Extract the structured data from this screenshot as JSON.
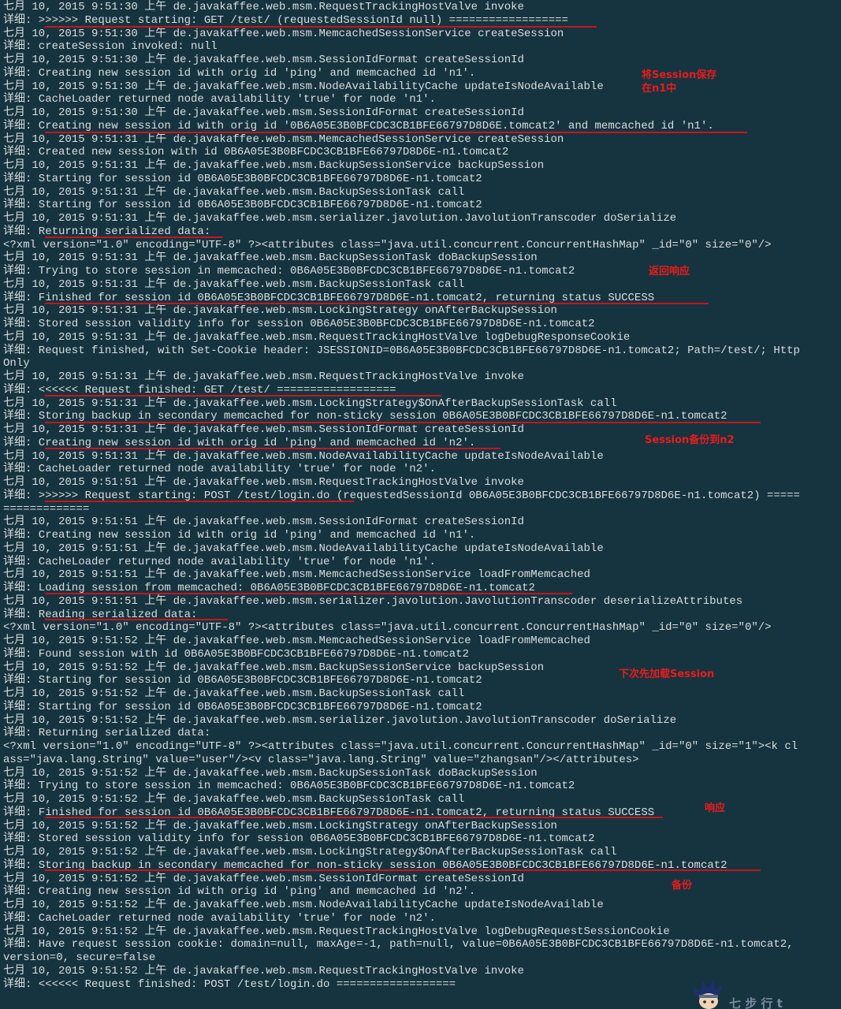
{
  "log_lines": [
    "七月 10, 2015 9:51:30 上午 de.javakaffee.web.msm.RequestTrackingHostValve invoke",
    "详细: >>>>>> Request starting: GET /test/ (requestedSessionId null) ==================",
    "七月 10, 2015 9:51:30 上午 de.javakaffee.web.msm.MemcachedSessionService createSession",
    "详细: createSession invoked: null",
    "七月 10, 2015 9:51:30 上午 de.javakaffee.web.msm.SessionIdFormat createSessionId",
    "详细: Creating new session id with orig id 'ping' and memcached id 'n1'.",
    "七月 10, 2015 9:51:30 上午 de.javakaffee.web.msm.NodeAvailabilityCache updateIsNodeAvailable",
    "详细: CacheLoader returned node availability 'true' for node 'n1'.",
    "七月 10, 2015 9:51:30 上午 de.javakaffee.web.msm.SessionIdFormat createSessionId",
    "详细: Creating new session id with orig id '0B6A05E3B0BFCDC3CB1BFE66797D8D6E.tomcat2' and memcached id 'n1'.",
    "七月 10, 2015 9:51:31 上午 de.javakaffee.web.msm.MemcachedSessionService createSession",
    "详细: Created new session with id 0B6A05E3B0BFCDC3CB1BFE66797D8D6E-n1.tomcat2",
    "七月 10, 2015 9:51:31 上午 de.javakaffee.web.msm.BackupSessionService backupSession",
    "详细: Starting for session id 0B6A05E3B0BFCDC3CB1BFE66797D8D6E-n1.tomcat2",
    "七月 10, 2015 9:51:31 上午 de.javakaffee.web.msm.BackupSessionTask call",
    "详细: Starting for session id 0B6A05E3B0BFCDC3CB1BFE66797D8D6E-n1.tomcat2",
    "七月 10, 2015 9:51:31 上午 de.javakaffee.web.msm.serializer.javolution.JavolutionTranscoder doSerialize",
    "详细: Returning serialized data:",
    "<?xml version=\"1.0\" encoding=\"UTF-8\" ?><attributes class=\"java.util.concurrent.ConcurrentHashMap\" _id=\"0\" size=\"0\"/>",
    "七月 10, 2015 9:51:31 上午 de.javakaffee.web.msm.BackupSessionTask doBackupSession",
    "详细: Trying to store session in memcached: 0B6A05E3B0BFCDC3CB1BFE66797D8D6E-n1.tomcat2",
    "七月 10, 2015 9:51:31 上午 de.javakaffee.web.msm.BackupSessionTask call",
    "详细: Finished for session id 0B6A05E3B0BFCDC3CB1BFE66797D8D6E-n1.tomcat2, returning status SUCCESS",
    "七月 10, 2015 9:51:31 上午 de.javakaffee.web.msm.LockingStrategy onAfterBackupSession",
    "详细: Stored session validity info for session 0B6A05E3B0BFCDC3CB1BFE66797D8D6E-n1.tomcat2",
    "七月 10, 2015 9:51:31 上午 de.javakaffee.web.msm.RequestTrackingHostValve logDebugResponseCookie",
    "详细: Request finished, with Set-Cookie header: JSESSIONID=0B6A05E3B0BFCDC3CB1BFE66797D8D6E-n1.tomcat2; Path=/test/; Http",
    "Only",
    "七月 10, 2015 9:51:31 上午 de.javakaffee.web.msm.RequestTrackingHostValve invoke",
    "详细: <<<<<< Request finished: GET /test/ ==================",
    "七月 10, 2015 9:51:31 上午 de.javakaffee.web.msm.LockingStrategy$OnAfterBackupSessionTask call",
    "详细: Storing backup in secondary memcached for non-sticky session 0B6A05E3B0BFCDC3CB1BFE66797D8D6E-n1.tomcat2",
    "七月 10, 2015 9:51:31 上午 de.javakaffee.web.msm.SessionIdFormat createSessionId",
    "详细: Creating new session id with orig id 'ping' and memcached id 'n2'.",
    "七月 10, 2015 9:51:31 上午 de.javakaffee.web.msm.NodeAvailabilityCache updateIsNodeAvailable",
    "详细: CacheLoader returned node availability 'true' for node 'n2'.",
    "七月 10, 2015 9:51:51 上午 de.javakaffee.web.msm.RequestTrackingHostValve invoke",
    "详细: >>>>>> Request starting: POST /test/login.do (requestedSessionId 0B6A05E3B0BFCDC3CB1BFE66797D8D6E-n1.tomcat2) =====",
    "=============",
    "七月 10, 2015 9:51:51 上午 de.javakaffee.web.msm.SessionIdFormat createSessionId",
    "详细: Creating new session id with orig id 'ping' and memcached id 'n1'.",
    "七月 10, 2015 9:51:51 上午 de.javakaffee.web.msm.NodeAvailabilityCache updateIsNodeAvailable",
    "详细: CacheLoader returned node availability 'true' for node 'n1'.",
    "七月 10, 2015 9:51:51 上午 de.javakaffee.web.msm.MemcachedSessionService loadFromMemcached",
    "详细: Loading session from memcached: 0B6A05E3B0BFCDC3CB1BFE66797D8D6E-n1.tomcat2",
    "七月 10, 2015 9:51:51 上午 de.javakaffee.web.msm.serializer.javolution.JavolutionTranscoder deserializeAttributes",
    "详细: Reading serialized data:",
    "<?xml version=\"1.0\" encoding=\"UTF-8\" ?><attributes class=\"java.util.concurrent.ConcurrentHashMap\" _id=\"0\" size=\"0\"/>",
    "七月 10, 2015 9:51:52 上午 de.javakaffee.web.msm.MemcachedSessionService loadFromMemcached",
    "详细: Found session with id 0B6A05E3B0BFCDC3CB1BFE66797D8D6E-n1.tomcat2",
    "七月 10, 2015 9:51:52 上午 de.javakaffee.web.msm.BackupSessionService backupSession",
    "详细: Starting for session id 0B6A05E3B0BFCDC3CB1BFE66797D8D6E-n1.tomcat2",
    "七月 10, 2015 9:51:52 上午 de.javakaffee.web.msm.BackupSessionTask call",
    "详细: Starting for session id 0B6A05E3B0BFCDC3CB1BFE66797D8D6E-n1.tomcat2",
    "七月 10, 2015 9:51:52 上午 de.javakaffee.web.msm.serializer.javolution.JavolutionTranscoder doSerialize",
    "详细: Returning serialized data:",
    "<?xml version=\"1.0\" encoding=\"UTF-8\" ?><attributes class=\"java.util.concurrent.ConcurrentHashMap\" _id=\"0\" size=\"1\"><k cl",
    "ass=\"java.lang.String\" value=\"user\"/><v class=\"java.lang.String\" value=\"zhangsan\"/></attributes>",
    "七月 10, 2015 9:51:52 上午 de.javakaffee.web.msm.BackupSessionTask doBackupSession",
    "详细: Trying to store session in memcached: 0B6A05E3B0BFCDC3CB1BFE66797D8D6E-n1.tomcat2",
    "七月 10, 2015 9:51:52 上午 de.javakaffee.web.msm.BackupSessionTask call",
    "详细: Finished for session id 0B6A05E3B0BFCDC3CB1BFE66797D8D6E-n1.tomcat2, returning status SUCCESS",
    "七月 10, 2015 9:51:52 上午 de.javakaffee.web.msm.LockingStrategy onAfterBackupSession",
    "详细: Stored session validity info for session 0B6A05E3B0BFCDC3CB1BFE66797D8D6E-n1.tomcat2",
    "七月 10, 2015 9:51:52 上午 de.javakaffee.web.msm.LockingStrategy$OnAfterBackupSessionTask call",
    "详细: Storing backup in secondary memcached for non-sticky session 0B6A05E3B0BFCDC3CB1BFE66797D8D6E-n1.tomcat2",
    "七月 10, 2015 9:51:52 上午 de.javakaffee.web.msm.SessionIdFormat createSessionId",
    "详细: Creating new session id with orig id 'ping' and memcached id 'n2'.",
    "七月 10, 2015 9:51:52 上午 de.javakaffee.web.msm.NodeAvailabilityCache updateIsNodeAvailable",
    "详细: CacheLoader returned node availability 'true' for node 'n2'.",
    "七月 10, 2015 9:51:52 上午 de.javakaffee.web.msm.RequestTrackingHostValve logDebugRequestSessionCookie",
    "详细: Have request session cookie: domain=null, maxAge=-1, path=null, value=0B6A05E3B0BFCDC3CB1BFE66797D8D6E-n1.tomcat2,",
    "version=0, secure=false",
    "七月 10, 2015 9:51:52 上午 de.javakaffee.web.msm.RequestTrackingHostValve invoke",
    "详细: <<<<<< Request finished: POST /test/login.do =================="
  ],
  "annotations": {
    "save_in_n1": "将Session保存\n在n1中",
    "return_response": "返回响应",
    "backup_to_n2": "Session备份到n2",
    "load_session_next": "下次先加载Session",
    "response": "响应",
    "backup": "备份"
  },
  "watermark_icon": "anime-avatar-icon",
  "watermark_text": "七 步 行 t",
  "colors": {
    "background": "#16343f",
    "text": "#d8dee0",
    "annotation": "#ea1b1b",
    "underline": "#c8141c"
  }
}
